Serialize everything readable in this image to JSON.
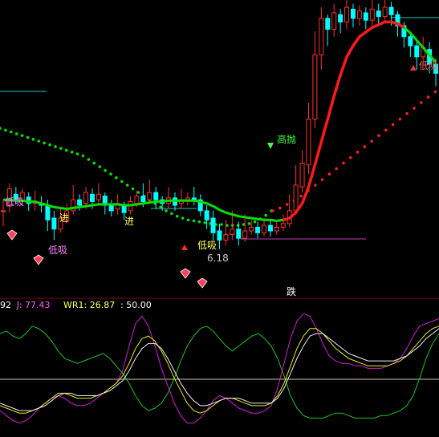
{
  "chart_data": [
    {
      "type": "candlestick",
      "title": "",
      "colors": {
        "up": "#ff3030",
        "down": "#00ffff",
        "bg": "#000000",
        "grid": "#800000"
      },
      "candles": [
        [
          150,
          150,
          162,
          133
        ],
        [
          155,
          174,
          180,
          148
        ],
        [
          168,
          162,
          176,
          158
        ],
        [
          160,
          170,
          174,
          156
        ],
        [
          165,
          158,
          170,
          150
        ],
        [
          158,
          160,
          172,
          150
        ],
        [
          158,
          156,
          166,
          148
        ],
        [
          155,
          140,
          162,
          128
        ],
        [
          142,
          130,
          150,
          118
        ],
        [
          130,
          142,
          152,
          126
        ],
        [
          140,
          150,
          158,
          136
        ],
        [
          150,
          162,
          178,
          146
        ],
        [
          162,
          156,
          168,
          150
        ],
        [
          158,
          170,
          176,
          152
        ],
        [
          168,
          160,
          174,
          152
        ],
        [
          162,
          168,
          180,
          158
        ],
        [
          166,
          156,
          170,
          146
        ],
        [
          156,
          150,
          162,
          144
        ],
        [
          152,
          158,
          168,
          146
        ],
        [
          156,
          148,
          160,
          140
        ],
        [
          150,
          160,
          166,
          146
        ],
        [
          158,
          166,
          172,
          154
        ],
        [
          166,
          160,
          180,
          154
        ],
        [
          162,
          170,
          184,
          158
        ],
        [
          170,
          162,
          176,
          152
        ],
        [
          162,
          158,
          166,
          150
        ],
        [
          158,
          164,
          176,
          152
        ],
        [
          164,
          156,
          170,
          150
        ],
        [
          158,
          162,
          174,
          152
        ],
        [
          162,
          164,
          170,
          156
        ],
        [
          164,
          162,
          176,
          156
        ],
        [
          162,
          150,
          168,
          144
        ],
        [
          150,
          140,
          156,
          130
        ],
        [
          142,
          126,
          150,
          118
        ],
        [
          128,
          118,
          136,
          108
        ],
        [
          118,
          124,
          140,
          112
        ],
        [
          124,
          130,
          150,
          118
        ],
        [
          130,
          120,
          138,
          112
        ],
        [
          120,
          128,
          146,
          116
        ],
        [
          128,
          132,
          140,
          124
        ],
        [
          132,
          126,
          138,
          120
        ],
        [
          126,
          134,
          142,
          122
        ],
        [
          134,
          128,
          140,
          122
        ],
        [
          128,
          132,
          138,
          124
        ],
        [
          132,
          136,
          146,
          128
        ],
        [
          136,
          150,
          168,
          132
        ],
        [
          150,
          178,
          200,
          146
        ],
        [
          176,
          202,
          216,
          170
        ],
        [
          200,
          250,
          268,
          190
        ],
        [
          250,
          320,
          346,
          240
        ],
        [
          320,
          360,
          372,
          304
        ],
        [
          360,
          348,
          364,
          330
        ],
        [
          348,
          366,
          376,
          340
        ],
        [
          364,
          356,
          370,
          344
        ],
        [
          356,
          372,
          384,
          348
        ],
        [
          370,
          360,
          376,
          350
        ],
        [
          360,
          368,
          374,
          352
        ],
        [
          366,
          358,
          372,
          348
        ],
        [
          358,
          370,
          380,
          352
        ],
        [
          368,
          362,
          376,
          354
        ],
        [
          362,
          372,
          388,
          356
        ],
        [
          372,
          364,
          378,
          352
        ],
        [
          364,
          352,
          368,
          340
        ],
        [
          352,
          340,
          356,
          328
        ],
        [
          340,
          330,
          344,
          318
        ],
        [
          330,
          318,
          336,
          304
        ],
        [
          318,
          328,
          340,
          310
        ],
        [
          326,
          310,
          334,
          300
        ],
        [
          310,
          300,
          316,
          286
        ]
      ],
      "ma_green": [
        162,
        162,
        161,
        161,
        160,
        160,
        158,
        156,
        154,
        153,
        152,
        153,
        154,
        155,
        156,
        157,
        157,
        157,
        157,
        156,
        156,
        157,
        158,
        159,
        160,
        160,
        161,
        161,
        161,
        161,
        161,
        160,
        158,
        155,
        151,
        148,
        146,
        144,
        143,
        142,
        141,
        140,
        140,
        139,
        140,
        142,
        148,
        158,
        176,
        200,
        225,
        250,
        275,
        298,
        318,
        330,
        340,
        345,
        350,
        353,
        356,
        356,
        354,
        350,
        344,
        336,
        328,
        320,
        312
      ],
      "dotted_green": [
        240,
        238,
        236,
        234,
        232,
        230,
        228,
        226,
        224,
        222,
        220,
        218,
        216,
        214,
        212,
        210,
        206,
        202,
        198,
        194,
        190,
        186,
        182,
        178,
        174,
        170,
        166,
        162,
        158,
        154,
        150,
        147,
        144,
        142,
        140,
        139,
        138,
        137,
        136,
        135,
        135,
        134,
        134,
        134,
        135,
        136,
        138,
        141,
        145,
        150
      ],
      "dotted_red": [
        150,
        153,
        157,
        161,
        166,
        172,
        178,
        184,
        190,
        196,
        202,
        208,
        214,
        220,
        226,
        232,
        238,
        244,
        250,
        256,
        262,
        268,
        274,
        280
      ],
      "annotations": [
        "低吸",
        "进",
        "进",
        "低吸",
        "6.18",
        "高抛",
        "低吸",
        "跌"
      ],
      "osc_labels": [
        "92",
        "J: 77.43",
        "WR1: 26.87",
        ": 50.00"
      ],
      "osc": {
        "green": [
          80,
          82,
          78,
          76,
          80,
          86,
          84,
          80,
          74,
          66,
          60,
          58,
          56,
          58,
          60,
          62,
          64,
          60,
          54,
          48,
          40,
          30,
          22,
          18,
          20,
          24,
          32,
          44,
          58,
          70,
          78,
          84,
          86,
          82,
          76,
          70,
          66,
          70,
          74,
          78,
          80,
          76,
          70,
          60,
          46,
          30,
          20,
          14,
          12,
          12,
          12,
          14,
          16,
          16,
          14,
          12,
          12,
          12,
          12,
          14,
          14,
          16,
          18,
          22,
          30,
          44,
          60,
          72,
          80
        ],
        "magenta": [
          18,
          14,
          10,
          8,
          10,
          14,
          20,
          24,
          28,
          30,
          28,
          24,
          22,
          22,
          24,
          28,
          32,
          36,
          40,
          50,
          70,
          88,
          94,
          86,
          70,
          52,
          38,
          24,
          14,
          8,
          8,
          12,
          18,
          26,
          30,
          28,
          24,
          20,
          18,
          16,
          16,
          18,
          22,
          36,
          56,
          76,
          90,
          96,
          94,
          84,
          72,
          62,
          58,
          56,
          56,
          54,
          54,
          52,
          52,
          52,
          54,
          56,
          60,
          68,
          78,
          86,
          88,
          90,
          92
        ],
        "yellow": [
          22,
          20,
          18,
          16,
          16,
          18,
          20,
          24,
          28,
          32,
          32,
          30,
          28,
          28,
          28,
          30,
          32,
          36,
          40,
          46,
          56,
          68,
          76,
          78,
          74,
          66,
          56,
          44,
          34,
          24,
          18,
          16,
          18,
          22,
          26,
          28,
          28,
          26,
          24,
          22,
          22,
          22,
          24,
          30,
          40,
          54,
          68,
          78,
          84,
          84,
          80,
          74,
          68,
          64,
          60,
          58,
          56,
          54,
          54,
          54,
          54,
          56,
          58,
          62,
          68,
          74,
          80,
          84,
          86
        ],
        "white": [
          24,
          22,
          20,
          18,
          18,
          18,
          20,
          22,
          26,
          30,
          32,
          32,
          30,
          30,
          30,
          30,
          32,
          34,
          38,
          42,
          50,
          60,
          68,
          72,
          72,
          68,
          60,
          50,
          40,
          32,
          26,
          22,
          22,
          24,
          26,
          28,
          28,
          28,
          26,
          24,
          24,
          24,
          24,
          28,
          36,
          48,
          60,
          70,
          78,
          80,
          80,
          76,
          72,
          68,
          64,
          62,
          60,
          58,
          58,
          58,
          58,
          58,
          60,
          62,
          66,
          70,
          76,
          80,
          84
        ]
      }
    }
  ]
}
